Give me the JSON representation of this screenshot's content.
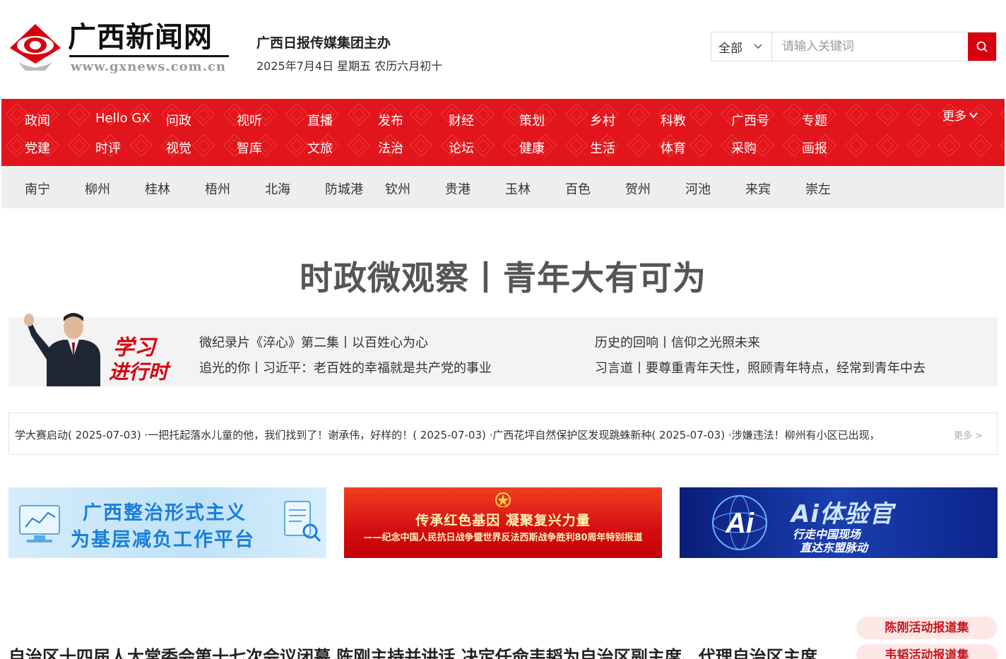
{
  "header": {
    "logo_title": "广西新闻网",
    "logo_url": "www.gxnews.com.cn",
    "org": "广西日报传媒集团主办",
    "date": "2025年7月4日 星期五 农历六月初十"
  },
  "search": {
    "scope": "全部",
    "placeholder": "请输入关键词"
  },
  "nav": {
    "row1": [
      "政闻",
      "Hello GX",
      "问政",
      "视听",
      "直播",
      "发布",
      "财经",
      "策划",
      "乡村",
      "科教",
      "广西号",
      "专题"
    ],
    "row2": [
      "党建",
      "时评",
      "视觉",
      "智库",
      "文旅",
      "法治",
      "论坛",
      "健康",
      "生活",
      "体育",
      "采购",
      "画报"
    ],
    "more": "更多"
  },
  "cities": [
    "南宁",
    "柳州",
    "桂林",
    "梧州",
    "北海",
    "防城港",
    "钦州",
    "贵港",
    "玉林",
    "百色",
    "贺州",
    "河池",
    "来宾",
    "崇左"
  ],
  "headline": "时政微观察丨青年大有可为",
  "study": {
    "logo_line1": "学习",
    "logo_line2": "进行时",
    "links": [
      "微纪录片《淬心》第二集丨以百姓心为心",
      "历史的回响丨信仰之光照未来",
      "追光的你丨习近平：老百姓的幸福就是共产党的事业",
      "习言道丨要尊重青年天性，照顾青年特点，经常到青年中去"
    ]
  },
  "ticker": {
    "items": [
      "学大赛启动( 2025-07-03)",
      "·一把托起落水儿童的他，我们找到了！谢承伟，好样的！( 2025-07-03)",
      "·广西花坪自然保护区发现跳蛛新种( 2025-07-03)",
      "·涉嫌违法！柳州有小区已出现，"
    ],
    "more": "更多 >"
  },
  "banners": {
    "b1_line1": "广西整治形式主义",
    "b1_line2": "为基层减负工作平台",
    "b2_line1": "传承红色基因  凝聚复兴力量",
    "b2_line2": "——纪念中国人民抗日战争暨世界反法西斯战争胜利80周年特别报道",
    "b3_title": "Ai体验官",
    "b3_badge": "Ai",
    "b3_sub1": "行走中国现场",
    "b3_sub2": "直达东盟脉动"
  },
  "lead_title": "自治区十四届人大常委会第十七次会议闭幕 陈刚主持并讲话 决定任命韦韬为自治区副主席、代理自治区主席",
  "side_pills": [
    "陈刚活动报道集",
    "韦韬活动报道集"
  ],
  "colors": {
    "brand_red": "#e2141c",
    "search_button": "#d7000f",
    "city_bar": "#eeeeee",
    "pill_bg": "#fde7e7"
  }
}
